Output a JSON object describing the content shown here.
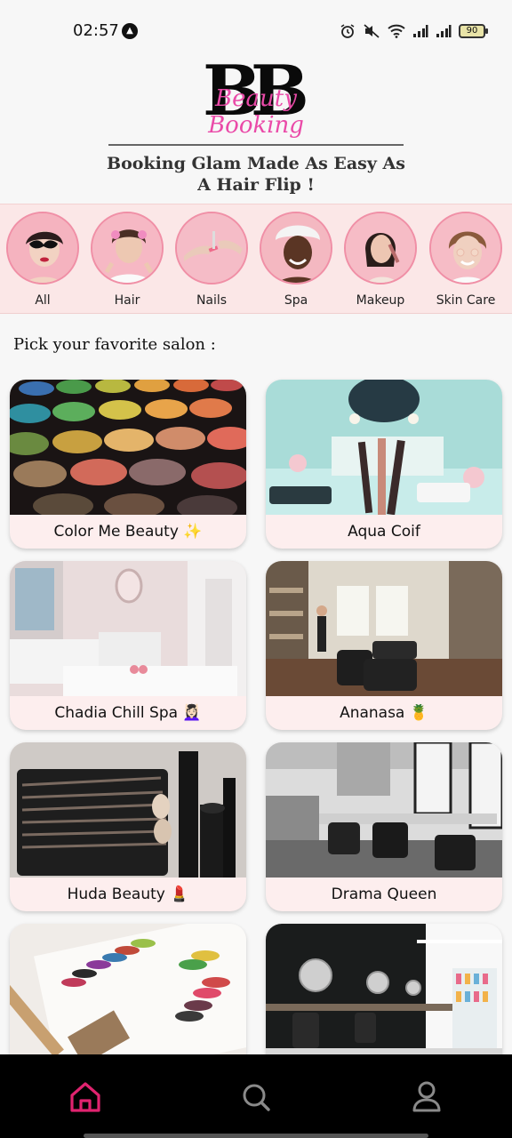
{
  "status_bar": {
    "time": "02:57",
    "battery_level": "90",
    "icons": [
      "alarm-icon",
      "mute-icon",
      "wifi-icon",
      "signal-icon",
      "signal-icon",
      "battery-icon"
    ]
  },
  "header": {
    "logo_initials": "BB",
    "logo_script": "Beauty Booking",
    "tagline_line1": "Booking Glam Made As Easy As",
    "tagline_line2": "A Hair Flip !"
  },
  "categories": [
    {
      "label": "All"
    },
    {
      "label": "Hair"
    },
    {
      "label": "Nails"
    },
    {
      "label": "Spa"
    },
    {
      "label": "Makeup"
    },
    {
      "label": "Skin Care"
    }
  ],
  "section_heading": "Pick your favorite salon :",
  "salons": [
    {
      "name": "Color Me Beauty ✨"
    },
    {
      "name": "Aqua Coif"
    },
    {
      "name": "Chadia Chill Spa 💆🏻‍♀️"
    },
    {
      "name": "Ananasa 🍍"
    },
    {
      "name": "Huda Beauty 💄"
    },
    {
      "name": "Drama Queen"
    },
    {
      "name": ""
    },
    {
      "name": ""
    }
  ],
  "bottom_nav": {
    "items": [
      "home-icon",
      "search-icon",
      "profile-icon"
    ],
    "active_color": "#e0236f",
    "inactive_color": "#8a8a8a"
  },
  "colors": {
    "brand_pink": "#ea4aa8",
    "category_bg": "#fbe7e7",
    "card_bg": "#fdeeee"
  }
}
